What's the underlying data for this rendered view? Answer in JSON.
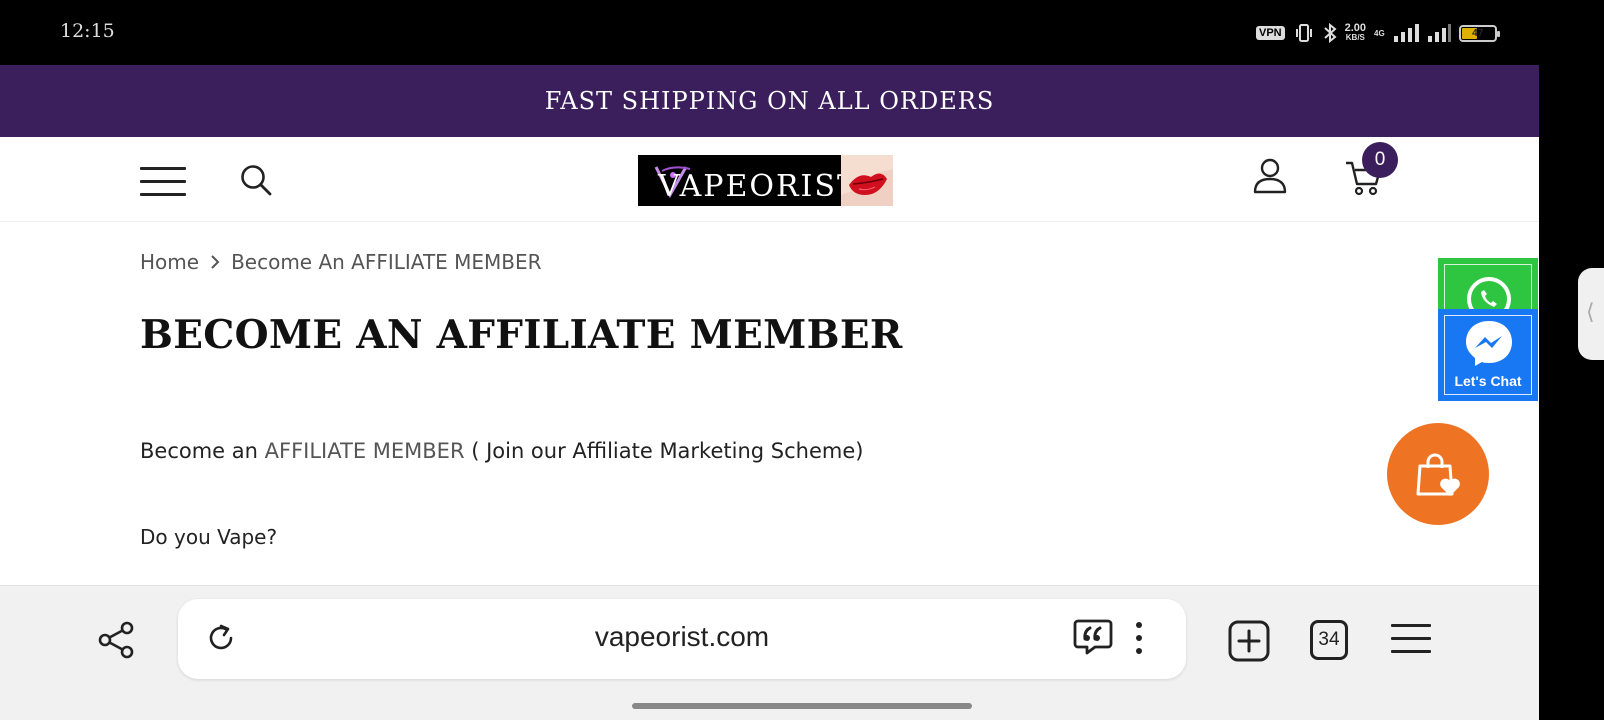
{
  "status_bar": {
    "time": "12:15",
    "vpn": "VPN",
    "speed_value": "2.00",
    "speed_unit": "KB/S",
    "network": "4G",
    "battery": "47"
  },
  "announcement": "FAST SHIPPING ON ALL ORDERS",
  "header": {
    "logo_text": "VAPEORIST",
    "cart_count": "0"
  },
  "breadcrumb": {
    "home": "Home",
    "current": "Become An AFFILIATE MEMBER"
  },
  "page": {
    "title": "BECOME AN AFFILIATE MEMBER",
    "intro_before": "Become an ",
    "intro_highlight": "AFFILIATE MEMBER",
    "intro_after": " ( Join our Affiliate Marketing Scheme)",
    "question": "Do you Vape?"
  },
  "widgets": {
    "messenger_label": "Let's Chat"
  },
  "browser": {
    "url": "vapeorist.com",
    "tab_count": "34"
  },
  "icons": {
    "menu": "hamburger-menu-icon",
    "search": "search-icon",
    "account": "user-icon",
    "cart": "cart-icon",
    "whatsapp": "whatsapp-icon",
    "messenger": "messenger-icon",
    "wishlist": "shopping-bag-heart-icon",
    "share": "share-icon",
    "reload": "reload-icon",
    "quote": "quote-bubble-icon",
    "more": "more-vertical-icon",
    "new_tab": "plus-square-icon"
  },
  "colors": {
    "brand_purple": "#3b1f5c",
    "whatsapp_green": "#2ec540",
    "messenger_blue": "#1877f2",
    "fab_orange": "#ee7424"
  }
}
